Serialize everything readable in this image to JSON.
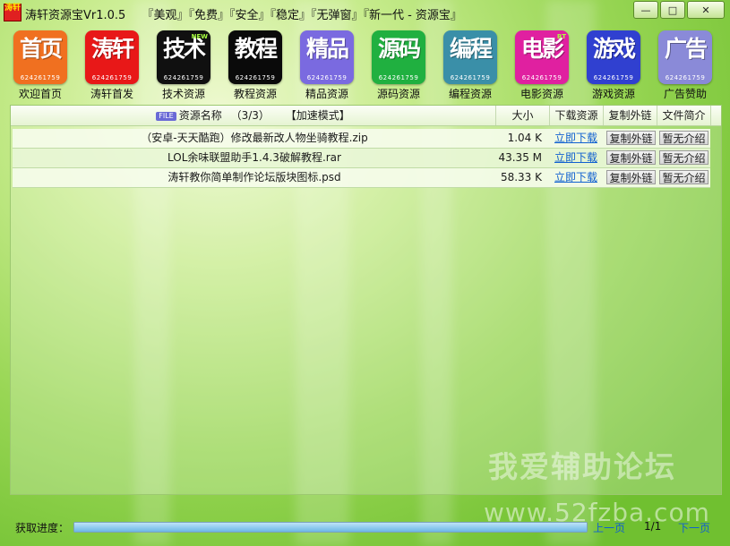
{
  "window": {
    "title": "涛轩资源宝Vr1.0.5",
    "slogan": "『美观』『免费』『安全』『稳定』『无弹窗』『新一代 - 资源宝』",
    "icon_text": "涛轩",
    "controls": {
      "minimize": "—",
      "maximize": "□",
      "close": "✕"
    }
  },
  "nav": {
    "items": [
      {
        "label": "欢迎首页",
        "icon_text": "首页",
        "number": "624261759",
        "color": "#f07020",
        "icon": "home-icon"
      },
      {
        "label": "涛轩首发",
        "icon_text": "涛轩",
        "number": "624261759",
        "color": "#e81818",
        "icon": "taoxuan-icon"
      },
      {
        "label": "技术资源",
        "icon_text": "技术",
        "number": "624261759",
        "color": "#101010",
        "icon": "tech-icon",
        "badge": "NEW"
      },
      {
        "label": "教程资源",
        "icon_text": "教程",
        "number": "624261759",
        "color": "#0a0a0a",
        "icon": "tutorial-icon"
      },
      {
        "label": "精品资源",
        "icon_text": "精品",
        "number": "624261759",
        "color": "#7a6ae0",
        "icon": "boutique-icon"
      },
      {
        "label": "源码资源",
        "icon_text": "源码",
        "number": "624261759",
        "color": "#20b040",
        "icon": "source-code-icon"
      },
      {
        "label": "编程资源",
        "icon_text": "编程",
        "number": "624261759",
        "color": "#3a8fa8",
        "icon": "programming-icon"
      },
      {
        "label": "电影资源",
        "icon_text": "电影",
        "number": "624261759",
        "color": "#e020a0",
        "icon": "movie-icon",
        "badge": "BT"
      },
      {
        "label": "游戏资源",
        "icon_text": "游戏",
        "number": "624261759",
        "color": "#3040d0",
        "icon": "game-icon"
      },
      {
        "label": "广告赞助",
        "icon_text": "广告",
        "number": "624261759",
        "color": "#8a8ad8",
        "icon": "ad-icon"
      }
    ]
  },
  "table": {
    "columns": {
      "file_tag": "FILE",
      "name": "资源名称",
      "count": "（3/3）",
      "mode": "【加速模式】",
      "size": "大小",
      "download": "下载资源",
      "copy": "复制外链",
      "intro": "文件简介"
    },
    "rows": [
      {
        "name": "（安卓-天天酷跑）修改最新改人物坐骑教程.zip",
        "size": "1.04 K",
        "download": "立即下载",
        "copy": "复制外链",
        "intro": "暂无介绍"
      },
      {
        "name": "LOL余味联盟助手1.4.3破解教程.rar",
        "size": "43.35 M",
        "download": "立即下载",
        "copy": "复制外链",
        "intro": "暂无介绍"
      },
      {
        "name": "涛轩教你简单制作论坛版块图标.psd",
        "size": "58.33 K",
        "download": "立即下载",
        "copy": "复制外链",
        "intro": "暂无介绍"
      }
    ]
  },
  "watermark": {
    "line1": "我爱辅助论坛",
    "line2": "www.52fzba.com"
  },
  "status": {
    "label": "获取进度：",
    "progress_percent": 100,
    "prev": "上一页",
    "page": "1/1",
    "next": "下一页"
  }
}
